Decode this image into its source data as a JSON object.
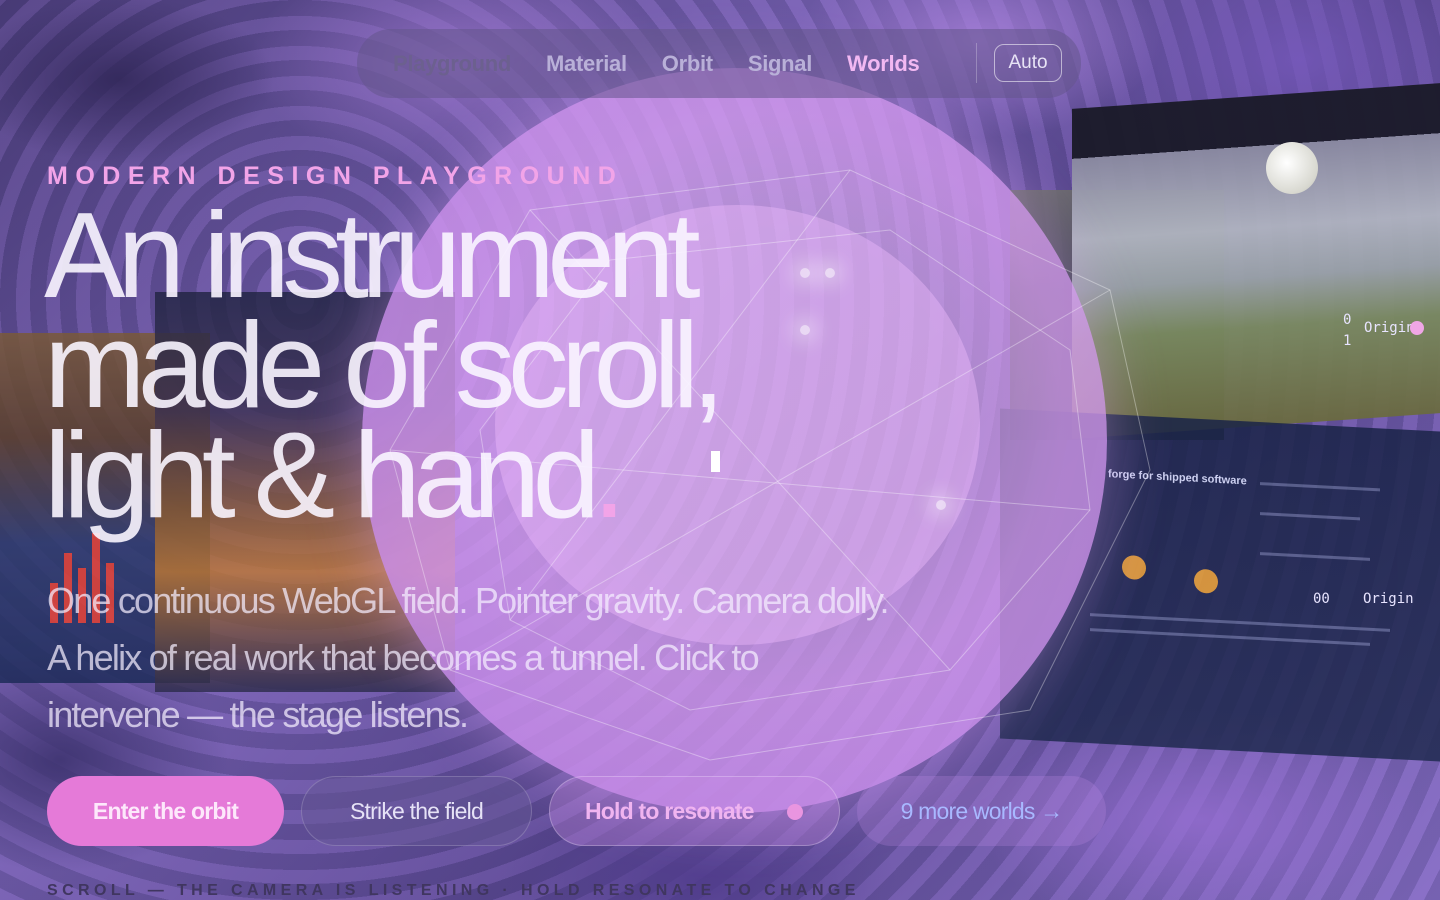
{
  "nav": {
    "items": [
      {
        "label": "Playground",
        "state": "muted"
      },
      {
        "label": "Material",
        "state": "default"
      },
      {
        "label": "Orbit",
        "state": "default"
      },
      {
        "label": "Signal",
        "state": "default"
      },
      {
        "label": "Worlds",
        "state": "active"
      }
    ],
    "mode_label": "Auto"
  },
  "hero": {
    "eyebrow": "MODERN DESIGN PLAYGROUND",
    "headline_line1": "An instrument",
    "headline_line2": "made of scroll,",
    "headline_line3": "light & hand",
    "headline_end": ".",
    "lede": "One continuous WebGL field. Pointer gravity. Camera dolly. A helix of real work that becomes a tunnel. Click to intervene — the stage listens."
  },
  "actions": {
    "primary": "Enter the orbit",
    "strike": "Strike the field",
    "hold": "Hold to resonate",
    "more": "9 more worlds →"
  },
  "footer": {
    "scroll_hint": "SCROLL — THE CAMERA IS LISTENING · HOLD RESONATE TO CHANGE"
  },
  "stage": {
    "origin_label_top": "Origin",
    "origin_label_bottom": "Origin",
    "coord_top": "0",
    "coord_top2": "1",
    "coord_bottom": "00",
    "dashboard_title": "forge for shipped software"
  },
  "colors": {
    "accent": "#e57ad8",
    "eyebrow": "#f2a4e8",
    "nav_active": "#f2b8f2",
    "more_link": "#a8b8ff"
  }
}
